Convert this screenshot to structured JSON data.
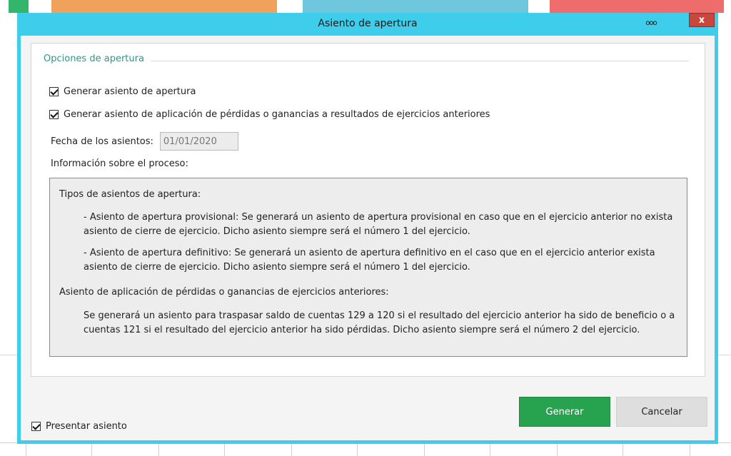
{
  "window": {
    "title": "Asiento de apertura",
    "close_label": "x",
    "more_label": "ooo"
  },
  "group": {
    "title": "Opciones de apertura"
  },
  "options": {
    "generar_apertura": {
      "label": "Generar asiento de apertura",
      "checked": true
    },
    "generar_aplicacion": {
      "label": "Generar asiento de aplicación de pérdidas o ganancias a resultados de ejercicios anteriores",
      "checked": true
    }
  },
  "fecha": {
    "label": "Fecha de los asientos:",
    "value": "01/01/2020"
  },
  "info": {
    "label": "Información sobre el proceso:",
    "tipos_title": "Tipos de asientos de apertura:",
    "provisional": "- Asiento de apertura provisional: Se generará un asiento de apertura provisional en caso que en el ejercicio anterior no exista asiento de cierre de ejercicio. Dicho asiento siempre será el número 1 del ejercicio.",
    "definitivo": "- Asiento de apertura definitivo: Se generará un asiento de apertura definitivo en el caso que en el ejercicio anterior exista asiento de cierre de ejercicio. Dicho asiento siempre será el número 1 del ejercicio.",
    "aplicacion_title": "Asiento de aplicación de pérdidas o ganancias de ejercicios anteriores:",
    "aplicacion": "Se generará un asiento para traspasar saldo de cuentas 129 a 120 si el resultado del ejercicio anterior ha sido de beneficio o a cuentas 121 si el resultado del ejercicio anterior ha sido pérdidas. Dicho asiento siempre será el número 2 del ejercicio."
  },
  "footer": {
    "presentar": {
      "label": "Presentar asiento",
      "checked": true
    },
    "generar_label": "Generar",
    "cancelar_label": "Cancelar"
  },
  "colors": {
    "dialog_frame": "#3ecdea",
    "accent_text": "#279a8c",
    "primary_button": "#27a34f",
    "close_button": "#c9463d"
  }
}
